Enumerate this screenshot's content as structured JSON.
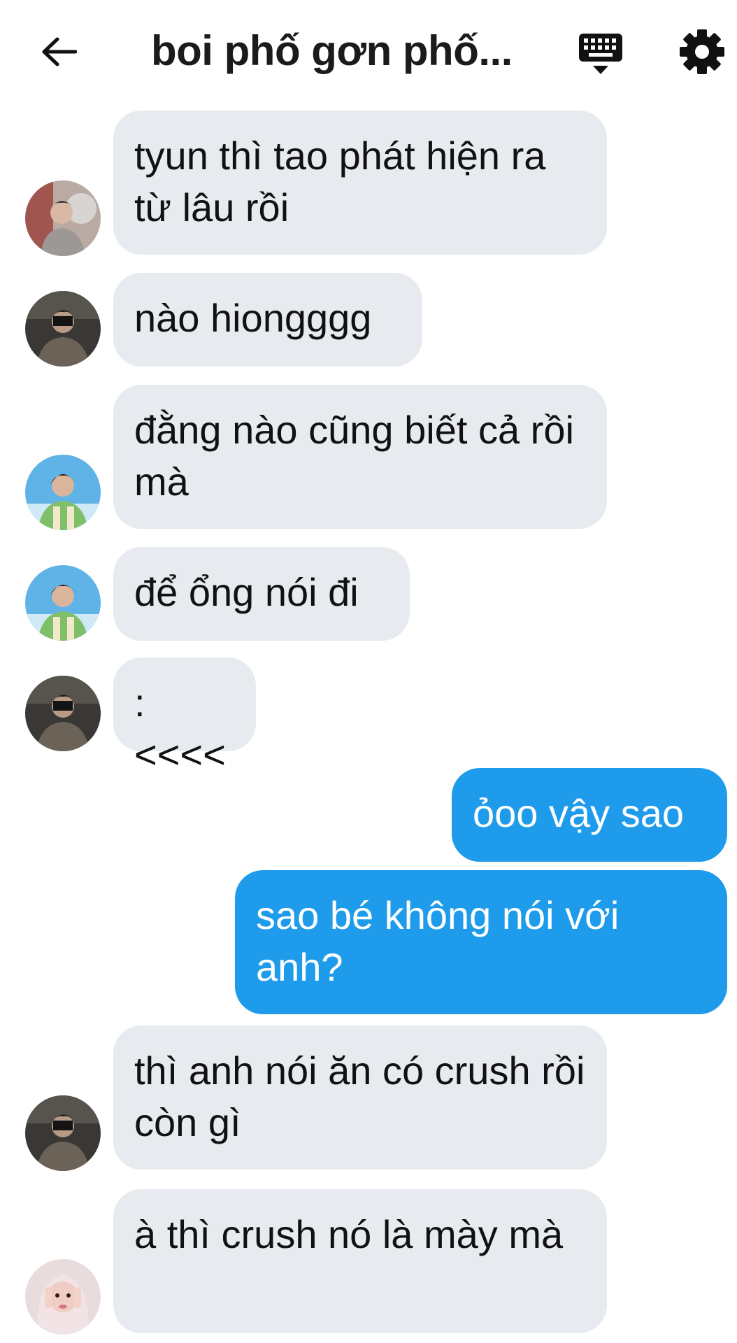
{
  "header": {
    "title": "boi phố gơn phố...",
    "back_icon": "arrow-left-icon",
    "keyboard_icon": "keyboard-icon",
    "settings_icon": "gear-icon"
  },
  "colors": {
    "incoming_bubble": "#e7eaee",
    "outgoing_bubble": "#1e9ceb",
    "background": "#ffffff"
  },
  "messages": [
    {
      "side": "incoming",
      "avatar": "avatar-boy-light",
      "text": "tyun thì tao phát hiện ra từ lâu rồi"
    },
    {
      "side": "incoming",
      "avatar": "avatar-boy-dark",
      "text": "nào hiongggg"
    },
    {
      "side": "incoming",
      "avatar": "avatar-boy-sky",
      "text": "đằng nào cũng biết cả rồi mà"
    },
    {
      "side": "incoming",
      "avatar": "avatar-boy-sky",
      "text": "để ổng nói đi"
    },
    {
      "side": "incoming",
      "avatar": "avatar-boy-dark",
      "text": ":<<<<"
    },
    {
      "side": "outgoing",
      "text": "ỏoo vậy sao"
    },
    {
      "side": "outgoing",
      "text": "sao bé không nói với anh?"
    },
    {
      "side": "incoming",
      "avatar": "avatar-boy-dark",
      "text": "thì anh nói ăn có crush rồi còn gì"
    },
    {
      "side": "incoming",
      "avatar": "avatar-girl-pink",
      "text": "à thì crush nó là mày mà"
    }
  ]
}
